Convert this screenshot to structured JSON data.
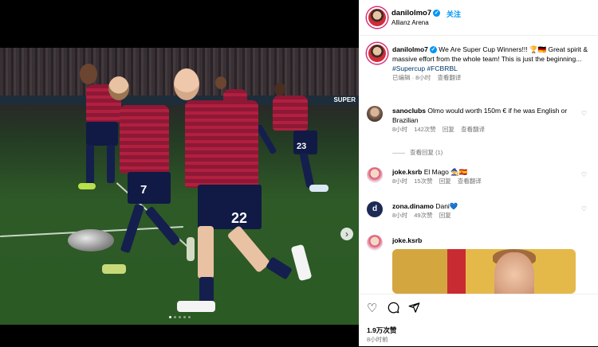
{
  "post": {
    "username": "danilolmo7",
    "follow_label": "关注",
    "location": "Allianz Arena",
    "caption_text": "We Are Super Cup Winners!!! 🏆🇩🇪 Great spirit & massive effort from the whole team! This is just the beginning...",
    "hashtags": "#Supercup #FCBRBL",
    "meta_edited": "已编辑 · 8小时",
    "meta_translate": "查看翻译",
    "photo_ad_text": "SUPER",
    "jersey_numbers": [
      "7",
      "22",
      "23"
    ],
    "carousel_dot_count": 5,
    "carousel_active_index": 0
  },
  "comments": [
    {
      "username": "sanoclubs",
      "text": "Olmo would worth 150m € if he was English or Brazilian",
      "time": "8小时",
      "likes": "142次赞",
      "reply": "回复",
      "translate": "查看翻译",
      "view_replies": "查看回复 (1)"
    },
    {
      "username": "joke.ksrb",
      "text": "El Mago 🧙🇪🇸",
      "time": "8小时",
      "likes": "15次赞",
      "reply": "回复",
      "translate": "查看翻译"
    },
    {
      "username": "zona.dinamo",
      "text": "Dani💙",
      "time": "8小时",
      "likes": "49次赞",
      "reply": "回复"
    },
    {
      "username": "joke.ksrb",
      "text": ""
    }
  ],
  "footer": {
    "likes": "1.9万次赞",
    "time": "8小时前"
  },
  "colors": {
    "link_blue": "#0095f6",
    "hashtag": "#00376b",
    "secondary_text": "#737373",
    "shirt_red": "#b1203f",
    "shorts_navy": "#101a44"
  },
  "icons": [
    "heart-icon",
    "comment-icon",
    "share-icon",
    "more-icon",
    "verified-icon",
    "chevron-right-icon"
  ]
}
